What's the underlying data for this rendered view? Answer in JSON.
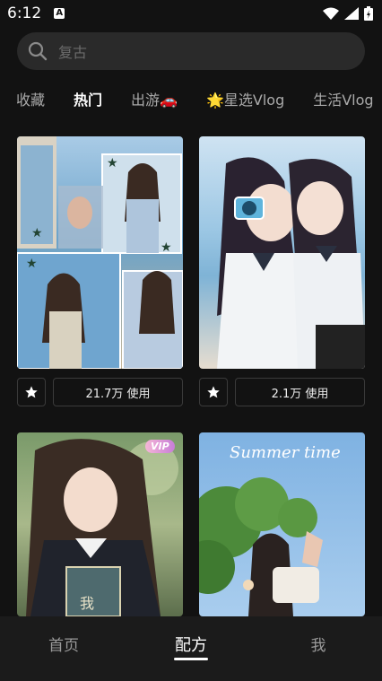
{
  "status_bar": {
    "time": "6:12",
    "notification_icon": "A"
  },
  "search": {
    "placeholder": "复古"
  },
  "tabs": [
    {
      "label": "收藏"
    },
    {
      "label": "热门"
    },
    {
      "label": "出游🚗"
    },
    {
      "label": "🌟星选Vlog"
    },
    {
      "label": "生活Vlog"
    }
  ],
  "cards": [
    {
      "use_label": "21.7万 使用"
    },
    {
      "use_label": "2.1万 使用"
    },
    {
      "badge": "VIP"
    },
    {
      "overlay_text": "Summer time"
    }
  ],
  "bottom_nav": {
    "items": [
      {
        "label": "首页"
      },
      {
        "label": "配方"
      },
      {
        "label": "我"
      }
    ]
  }
}
